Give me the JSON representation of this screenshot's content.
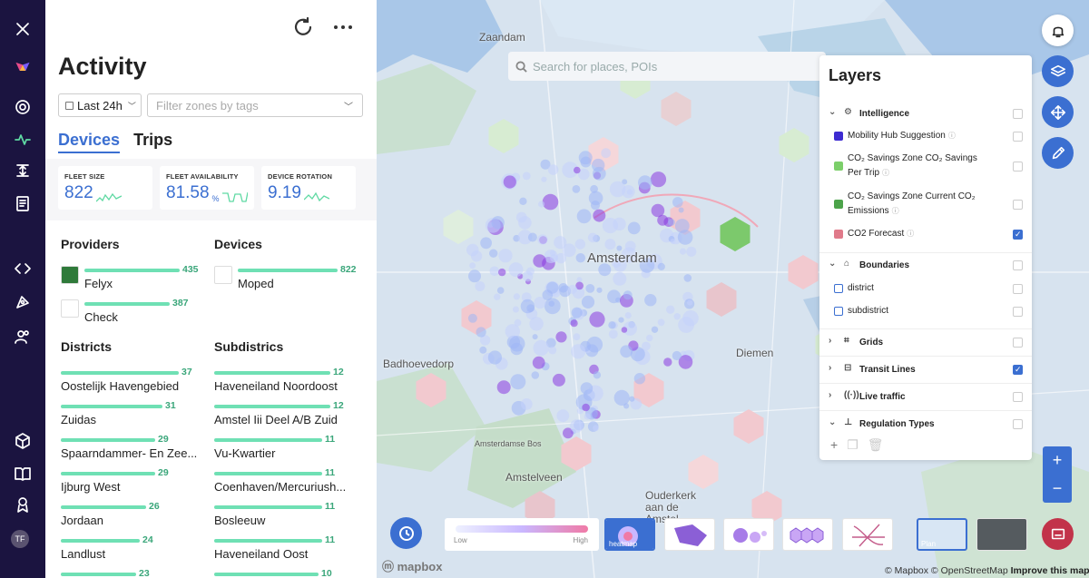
{
  "nav": {
    "close": "close-icon",
    "avatar_initials": "TF"
  },
  "panel": {
    "title": "Activity",
    "time_range": "Last 24h",
    "filter_placeholder": "Filter zones by tags",
    "tabs": [
      "Devices",
      "Trips"
    ],
    "kpis": [
      {
        "label": "FLEET SIZE",
        "value": "822",
        "unit": ""
      },
      {
        "label": "FLEET AVAILABILITY",
        "value": "81.58",
        "unit": "%"
      },
      {
        "label": "DEVICE ROTATION",
        "value": "9.19",
        "unit": ""
      }
    ],
    "providers_title": "Providers",
    "providers": [
      {
        "label": "Felyx",
        "count": "435",
        "fraction": 0.95
      },
      {
        "label": "Check",
        "count": "387",
        "fraction": 0.85
      }
    ],
    "devices_title": "Devices",
    "devices": [
      {
        "label": "Moped",
        "count": "822",
        "fraction": 1.0
      }
    ],
    "districts_title": "Districts",
    "districts": [
      {
        "label": "Oostelijk Havengebied",
        "count": "37",
        "fraction": 1.0
      },
      {
        "label": "Zuidas",
        "count": "31",
        "fraction": 0.86
      },
      {
        "label": "Spaarndammer- En Zee...",
        "count": "29",
        "fraction": 0.8
      },
      {
        "label": "Ijburg West",
        "count": "29",
        "fraction": 0.8
      },
      {
        "label": "Jordaan",
        "count": "26",
        "fraction": 0.72
      },
      {
        "label": "Landlust",
        "count": "24",
        "fraction": 0.67
      },
      {
        "label": "",
        "count": "23",
        "fraction": 0.64
      }
    ],
    "subdistricts_title": "Subdistrics",
    "subdistricts": [
      {
        "label": "Haveneiland Noordoost",
        "count": "12",
        "fraction": 1.0
      },
      {
        "label": "Amstel Iii Deel A/B Zuid",
        "count": "12",
        "fraction": 1.0
      },
      {
        "label": "Vu-Kwartier",
        "count": "11",
        "fraction": 0.93
      },
      {
        "label": "Coenhaven/Mercuriush...",
        "count": "11",
        "fraction": 0.93
      },
      {
        "label": "Bosleeuw",
        "count": "11",
        "fraction": 0.93
      },
      {
        "label": "Haveneiland Oost",
        "count": "11",
        "fraction": 0.93
      },
      {
        "label": "",
        "count": "10",
        "fraction": 0.9
      }
    ]
  },
  "map": {
    "search_placeholder": "Search for places, POIs",
    "places": [
      "Zaandam",
      "Amsterdam",
      "Badhoevedorp",
      "Diemen",
      "Amsterdamse Bos",
      "Amstelveen",
      "Ouderkerk aan de Amstel"
    ],
    "legend": {
      "low": "Low",
      "high": "High"
    },
    "view_modes": [
      "heatmap",
      "",
      "",
      "",
      ""
    ],
    "basemaps": [
      "Plan",
      ""
    ],
    "logo": "mapbox",
    "attribution": "© Mapbox © OpenStreetMap",
    "improve": "Improve this map"
  },
  "layers": {
    "title": "Layers",
    "groups": [
      {
        "label": "Intelligence",
        "expanded": true,
        "checked": false
      },
      {
        "label": "Boundaries",
        "expanded": true,
        "checked": false
      },
      {
        "label": "Grids",
        "expanded": false,
        "checked": false
      },
      {
        "label": "Transit Lines",
        "expanded": false,
        "checked": true
      },
      {
        "label": "Live traffic",
        "expanded": false,
        "checked": false
      },
      {
        "label": "Regulation Types",
        "expanded": true,
        "checked": false
      }
    ],
    "intelligence_items": [
      {
        "label": "Mobility Hub Suggestion",
        "checked": false,
        "color": "#3d2bd1"
      },
      {
        "label": "CO₂ Savings Zone CO₂ Savings Per Trip",
        "checked": false,
        "color": "#7ccf6a"
      },
      {
        "label": "CO₂ Savings Zone Current CO₂ Emissions",
        "checked": false,
        "color": "#4ca34a"
      },
      {
        "label": "CO2 Forecast",
        "checked": true,
        "color": "#e07a8a"
      }
    ],
    "boundary_items": [
      {
        "label": "district",
        "checked": false
      },
      {
        "label": "subdistrict",
        "checked": false
      }
    ]
  },
  "colors": {
    "rail": "#1b1440",
    "accent": "#3b6fd1",
    "bar": "#6fe0b4",
    "chat": "#c2334a"
  }
}
